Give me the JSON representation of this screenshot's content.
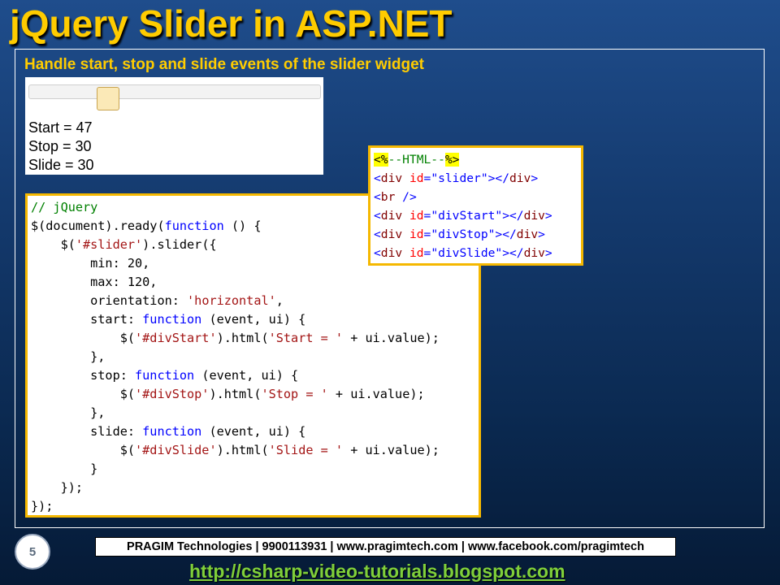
{
  "slide": {
    "title": "jQuery Slider in ASP.NET",
    "subtitle": "Handle start, stop and slide events of the slider widget",
    "page_number": "5"
  },
  "demo": {
    "slider_value": 47,
    "slider_min": 20,
    "slider_max": 120,
    "start_text": "Start = 47",
    "stop_text": "Stop = 30",
    "slide_text": "Slide = 30"
  },
  "js_code": [
    "// jQuery",
    "$(document).ready(function () {",
    "    $('#slider').slider({",
    "        min: 20,",
    "        max: 120,",
    "        orientation: 'horizontal',",
    "        start: function (event, ui) {",
    "            $('#divStart').html('Start = ' + ui.value);",
    "        },",
    "        stop: function (event, ui) {",
    "            $('#divStop').html('Stop = ' + ui.value);",
    "        },",
    "        slide: function (event, ui) {",
    "            $('#divSlide').html('Slide = ' + ui.value);",
    "        }",
    "    });",
    "});"
  ],
  "html_code": [
    "<%--HTML--%>",
    "<div id=\"slider\"></div>",
    "<br />",
    "<div id=\"divStart\"></div>",
    "<div id=\"divStop\"></div>",
    "<div id=\"divSlide\"></div>"
  ],
  "footer": {
    "company_line": "PRAGIM Technologies | 9900113931 | www.pragimtech.com | www.facebook.com/pragimtech",
    "blog_url": "http://csharp-video-tutorials.blogspot.com"
  },
  "colors": {
    "title": "#ffcc00",
    "code_border": "#f5b800",
    "link": "#7fcf3a"
  }
}
